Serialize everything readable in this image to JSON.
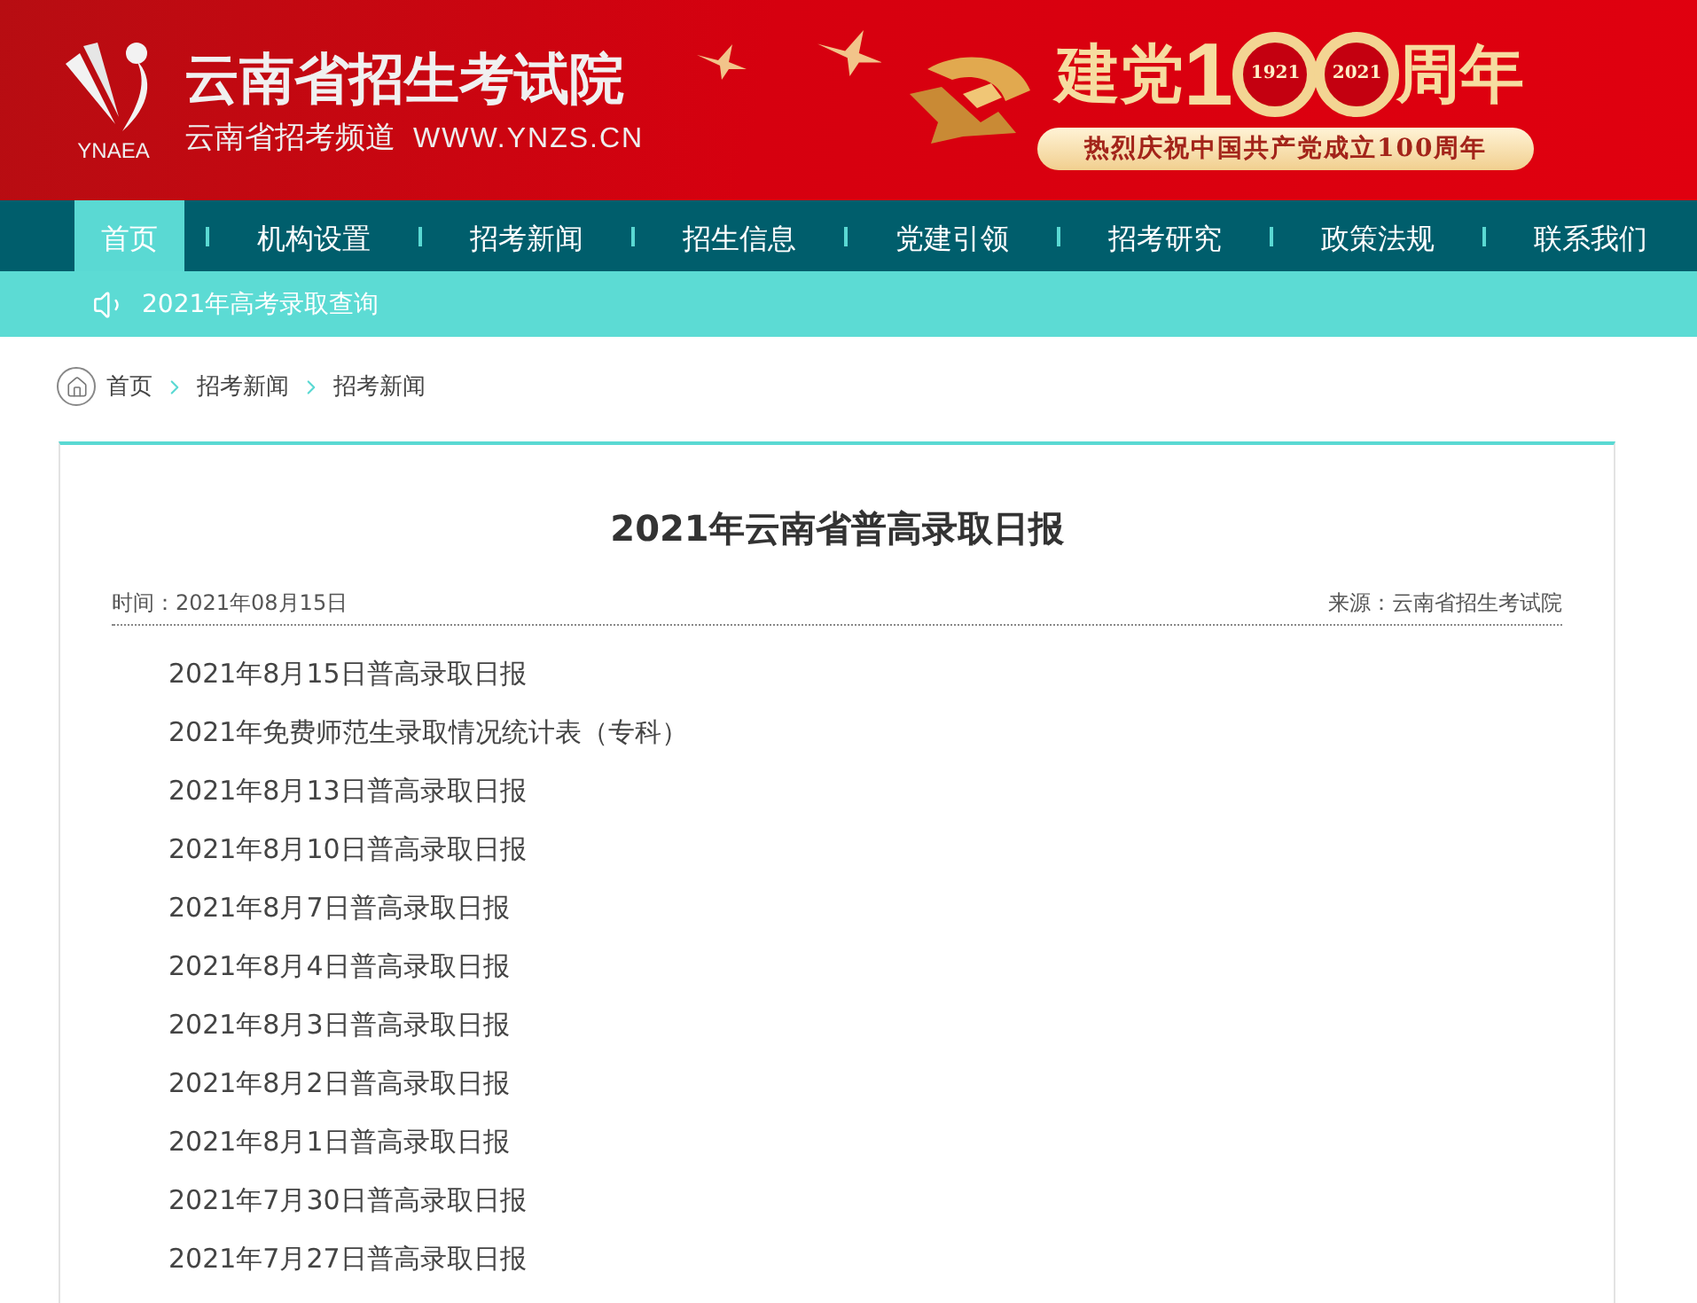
{
  "header": {
    "logo_caption": "YNAEA",
    "title": "云南省招生考试院",
    "subtitle": "云南省招考频道",
    "url": "WWW.YNZS.CN",
    "anniversary": {
      "lead": "建党",
      "number": "1",
      "years": [
        "1921",
        "2021"
      ],
      "tail": "周年",
      "slogan": "热烈庆祝中国共产党成立100周年"
    }
  },
  "nav": [
    {
      "label": "首页",
      "selected": true
    },
    {
      "label": "机构设置",
      "selected": false
    },
    {
      "label": "招考新闻",
      "selected": false
    },
    {
      "label": "招生信息",
      "selected": false
    },
    {
      "label": "党建引领",
      "selected": false
    },
    {
      "label": "招考研究",
      "selected": false
    },
    {
      "label": "政策法规",
      "selected": false
    },
    {
      "label": "联系我们",
      "selected": false
    }
  ],
  "notice": "2021年高考录取查询",
  "breadcrumb": [
    "首页",
    "招考新闻",
    "招考新闻"
  ],
  "article": {
    "title": "2021年云南省普高录取日报",
    "time": "时间：2021年08月15日",
    "source": "来源：云南省招生考试院",
    "links": [
      "2021年8月15日普高录取日报",
      "2021年免费师范生录取情况统计表（专科）",
      "2021年8月13日普高录取日报",
      "2021年8月10日普高录取日报",
      "2021年8月7日普高录取日报",
      "2021年8月4日普高录取日报",
      "2021年8月3日普高录取日报",
      "2021年8月2日普高录取日报",
      "2021年8月1日普高录取日报",
      "2021年7月30日普高录取日报",
      "2021年7月27日普高录取日报"
    ]
  }
}
